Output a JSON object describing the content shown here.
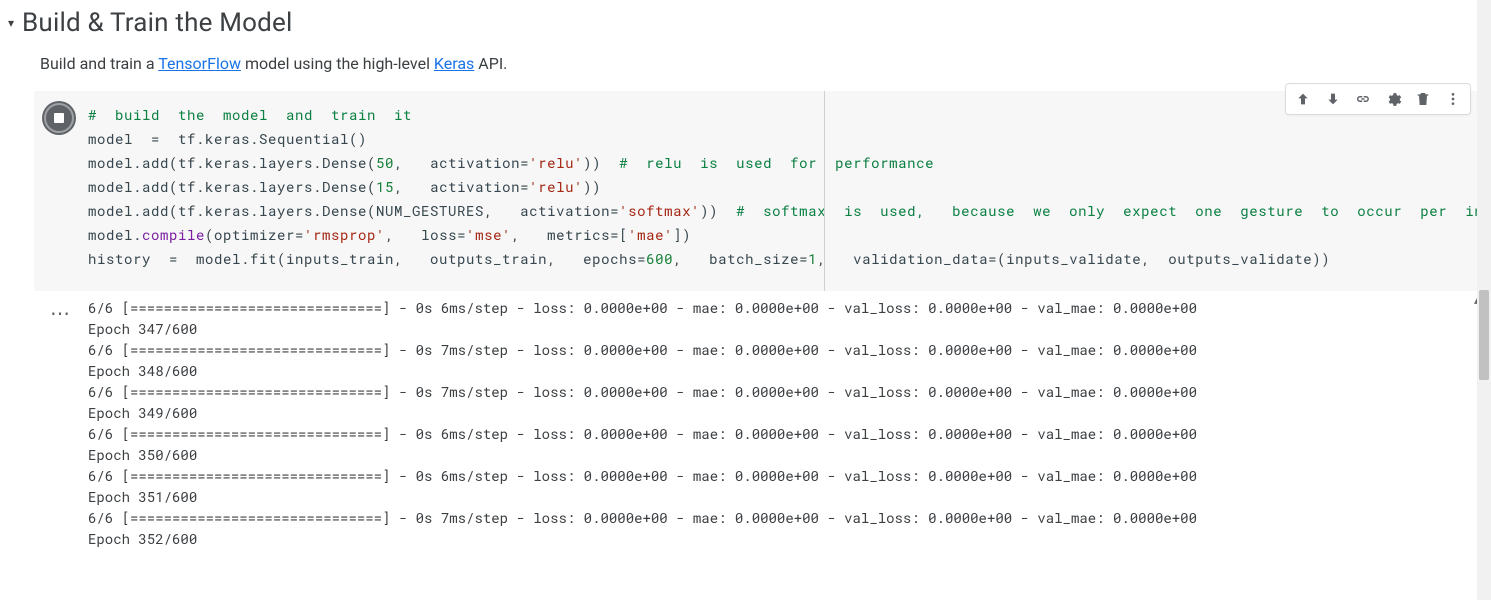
{
  "section": {
    "title": "Build & Train the Model",
    "desc_pre": "Build and train a ",
    "link1_text": "TensorFlow",
    "desc_mid": " model using the high-level ",
    "link2_text": "Keras",
    "desc_post": " API."
  },
  "toolbar": {
    "move_up": "↑",
    "move_down": "↓",
    "link": "⊂⊃",
    "settings": "⚙",
    "delete": "🗑",
    "more": "⋮"
  },
  "code": {
    "l1_comment": "#  build  the  model  and  train  it",
    "l2a": "model  =  tf.keras.Sequential()",
    "l3a": "model.add(tf.keras.layers.Dense(",
    "l3_num": "50",
    "l3b": ",   activation=",
    "l3_str": "'relu'",
    "l3c": "))  ",
    "l3_comment": "#  relu  is  used  for  performance",
    "l4a": "model.add(tf.keras.layers.Dense(",
    "l4_num": "15",
    "l4b": ",   activation=",
    "l4_str": "'relu'",
    "l4c": "))",
    "l5a": "model.add(tf.keras.layers.Dense(NUM_GESTURES,   activation=",
    "l5_str": "'softmax'",
    "l5b": "))  ",
    "l5_comment": "#  softmax  is  used,   because  we  only  expect  one  gesture  to  occur  per  input",
    "l6a": "model.",
    "l6_func": "compile",
    "l6b": "(optimizer=",
    "l6_str1": "'rmsprop'",
    "l6c": ",   loss=",
    "l6_str2": "'mse'",
    "l6d": ",   metrics=[",
    "l6_str3": "'mae'",
    "l6e": "])",
    "l7a": "history  =  model.fit(inputs_train,   outputs_train,   epochs=",
    "l7_num1": "600",
    "l7b": ",   batch_size=",
    "l7_num2": "1",
    "l7c": ",   validation_data=(inputs_validate,  outputs_validate))"
  },
  "output": {
    "menu_icon": "⋯",
    "scroll_up_icon": "▴",
    "lines": [
      "6/6 [==============================] - 0s 6ms/step - loss: 0.0000e+00 - mae: 0.0000e+00 - val_loss: 0.0000e+00 - val_mae: 0.0000e+00",
      "Epoch 347/600",
      "6/6 [==============================] - 0s 7ms/step - loss: 0.0000e+00 - mae: 0.0000e+00 - val_loss: 0.0000e+00 - val_mae: 0.0000e+00",
      "Epoch 348/600",
      "6/6 [==============================] - 0s 7ms/step - loss: 0.0000e+00 - mae: 0.0000e+00 - val_loss: 0.0000e+00 - val_mae: 0.0000e+00",
      "Epoch 349/600",
      "6/6 [==============================] - 0s 6ms/step - loss: 0.0000e+00 - mae: 0.0000e+00 - val_loss: 0.0000e+00 - val_mae: 0.0000e+00",
      "Epoch 350/600",
      "6/6 [==============================] - 0s 6ms/step - loss: 0.0000e+00 - mae: 0.0000e+00 - val_loss: 0.0000e+00 - val_mae: 0.0000e+00",
      "Epoch 351/600",
      "6/6 [==============================] - 0s 7ms/step - loss: 0.0000e+00 - mae: 0.0000e+00 - val_loss: 0.0000e+00 - val_mae: 0.0000e+00",
      "Epoch 352/600"
    ]
  }
}
